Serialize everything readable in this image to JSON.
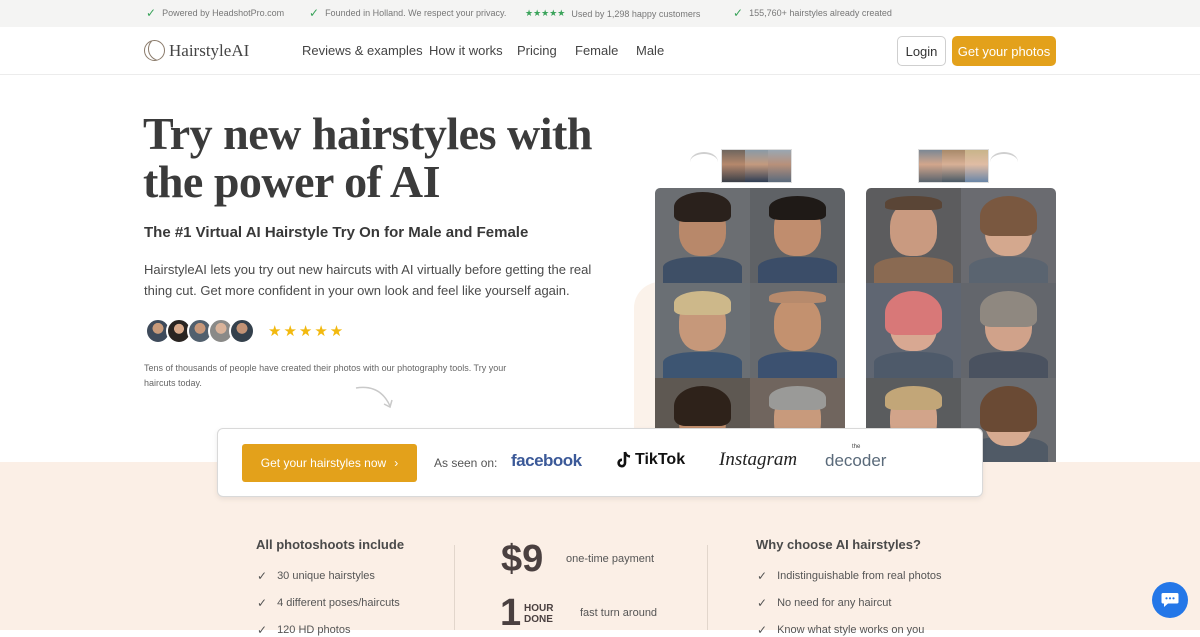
{
  "topbar": {
    "items": [
      "Powered by HeadshotPro.com",
      "Founded in Holland. We respect your privacy.",
      "Used by 1,298 happy customers",
      "155,760+ hairstyles already created"
    ],
    "stars": "★★★★★"
  },
  "nav": {
    "logo": "HairstyleAI",
    "links": [
      "Reviews & examples",
      "How it works",
      "Pricing",
      "Female",
      "Male"
    ],
    "login": "Login",
    "cta": "Get your photos"
  },
  "hero": {
    "title": "Try new hairstyles with the power of AI",
    "subtitle": "The #1 Virtual AI Hairstyle Try On for Male and Female",
    "description": "HairstyleAI lets you try out new haircuts with AI virtually before getting the real thing cut. Get more confident in your own look and feel like yourself again.",
    "stars": "★★★★★",
    "note": "Tens of thousands of people have created their photos with our photography tools. Try your haircuts today."
  },
  "cta": {
    "button": "Get your hairstyles now",
    "seen_on": "As seen on:",
    "brands": [
      "facebook",
      "TikTok",
      "Instagram",
      "decoder"
    ],
    "decoder_prefix": "the"
  },
  "features": {
    "left_title": "All photoshoots include",
    "left_items": [
      "30 unique hairstyles",
      "4 different poses/haircuts",
      "120 HD photos"
    ],
    "price": "$9",
    "price_label": "one-time payment",
    "turnaround_number": "1",
    "turnaround_unit_1": "HOUR",
    "turnaround_unit_2": "DONE",
    "turnaround_label": "fast turn around",
    "right_title": "Why choose AI hairstyles?",
    "right_items": [
      "Indistinguishable from real photos",
      "No need for any haircut",
      "Know what style works on you"
    ]
  },
  "colors": {
    "accent": "#e3a11b",
    "check": "#3aa35a",
    "peach": "#fbefe6",
    "chat": "#2477e8"
  },
  "icons": [
    "check-icon",
    "star-icon",
    "arrow-icon",
    "chat-icon",
    "tiktok-icon"
  ]
}
